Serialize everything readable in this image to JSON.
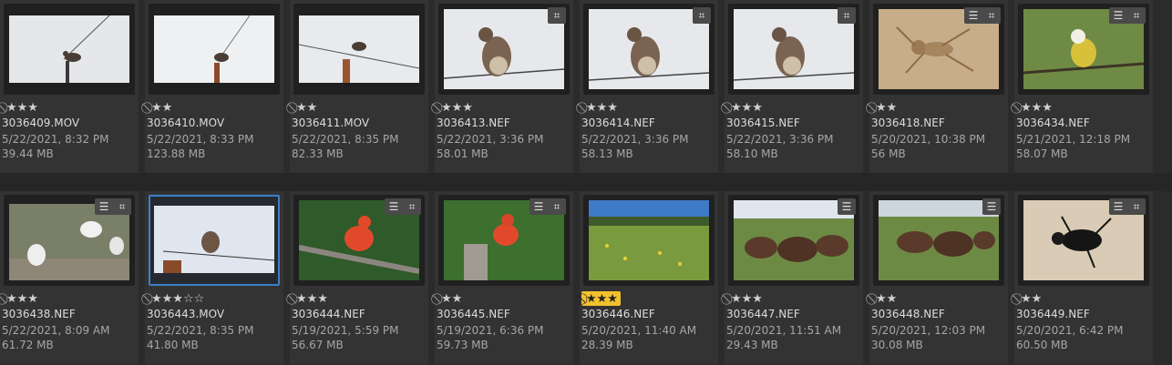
{
  "items": [
    {
      "name": "3036409.MOV",
      "date": "5/22/2021, 8:32 PM",
      "size": "39.44 MB",
      "stars": "★★★",
      "empty": "",
      "reject": "⃠",
      "badges": []
    },
    {
      "name": "3036410.MOV",
      "date": "5/22/2021, 8:33 PM",
      "size": "123.88 MB",
      "stars": "★★",
      "empty": "",
      "reject": "⃠",
      "badges": []
    },
    {
      "name": "3036411.MOV",
      "date": "5/22/2021, 8:35 PM",
      "size": "82.33 MB",
      "stars": "★★",
      "empty": "",
      "reject": "⃠",
      "badges": []
    },
    {
      "name": "3036413.NEF",
      "date": "5/22/2021, 3:36 PM",
      "size": "58.01 MB",
      "stars": "★★★",
      "empty": "",
      "reject": "⃠",
      "badges": [
        "crop-icon"
      ]
    },
    {
      "name": "3036414.NEF",
      "date": "5/22/2021, 3:36 PM",
      "size": "58.13 MB",
      "stars": "★★★",
      "empty": "",
      "reject": "⃠",
      "badges": [
        "crop-icon"
      ]
    },
    {
      "name": "3036415.NEF",
      "date": "5/22/2021, 3:36 PM",
      "size": "58.10 MB",
      "stars": "★★★",
      "empty": "",
      "reject": "⃠",
      "badges": [
        "crop-icon"
      ]
    },
    {
      "name": "3036418.NEF",
      "date": "5/20/2021, 10:38 PM",
      "size": "56 MB",
      "stars": "★★",
      "empty": "",
      "reject": "⃠",
      "badges": [
        "adjust-icon",
        "crop-icon"
      ]
    },
    {
      "name": "3036434.NEF",
      "date": "5/21/2021, 12:18 PM",
      "size": "58.07 MB",
      "stars": "★★★",
      "empty": "",
      "reject": "⃠",
      "badges": [
        "adjust-icon",
        "crop-icon"
      ]
    },
    {
      "name": "3036438.NEF",
      "date": "5/22/2021, 8:09 AM",
      "size": "61.72 MB",
      "stars": "★★★",
      "empty": "",
      "reject": "⃠",
      "badges": [
        "adjust-icon",
        "crop-icon"
      ]
    },
    {
      "name": "3036443.MOV",
      "date": "5/22/2021, 8:35 PM",
      "size": "41.80 MB",
      "stars": "★★★",
      "empty": "☆☆",
      "reject": "⃠",
      "badges": []
    },
    {
      "name": "3036444.NEF",
      "date": "5/19/2021, 5:59 PM",
      "size": "56.67 MB",
      "stars": "★★★",
      "empty": "",
      "reject": "⃠",
      "badges": [
        "adjust-icon",
        "crop-icon"
      ]
    },
    {
      "name": "3036445.NEF",
      "date": "5/19/2021, 6:36 PM",
      "size": "59.73 MB",
      "stars": "★★",
      "empty": "",
      "reject": "⃠",
      "badges": [
        "adjust-icon",
        "crop-icon"
      ]
    },
    {
      "name": "3036446.NEF",
      "date": "5/20/2021, 11:40 AM",
      "size": "28.39 MB",
      "stars": "★★★",
      "empty": "",
      "reject": "⃠",
      "badges": []
    },
    {
      "name": "3036447.NEF",
      "date": "5/20/2021, 11:51 AM",
      "size": "29.43 MB",
      "stars": "★★★",
      "empty": "",
      "reject": "⃠",
      "badges": [
        "adjust-icon"
      ]
    },
    {
      "name": "3036448.NEF",
      "date": "5/20/2021, 12:03 PM",
      "size": "30.08 MB",
      "stars": "★★",
      "empty": "",
      "reject": "⃠",
      "badges": [
        "adjust-icon"
      ]
    },
    {
      "name": "3036449.NEF",
      "date": "5/20/2021, 6:42 PM",
      "size": "60.50 MB",
      "stars": "★★",
      "empty": "",
      "reject": "⃠",
      "badges": [
        "adjust-icon",
        "crop-icon"
      ]
    }
  ],
  "colors": {
    "selected": "#3d7fc8",
    "highlight": "#f2c12e",
    "background": "#2b2b2b",
    "cell": "#333333"
  }
}
